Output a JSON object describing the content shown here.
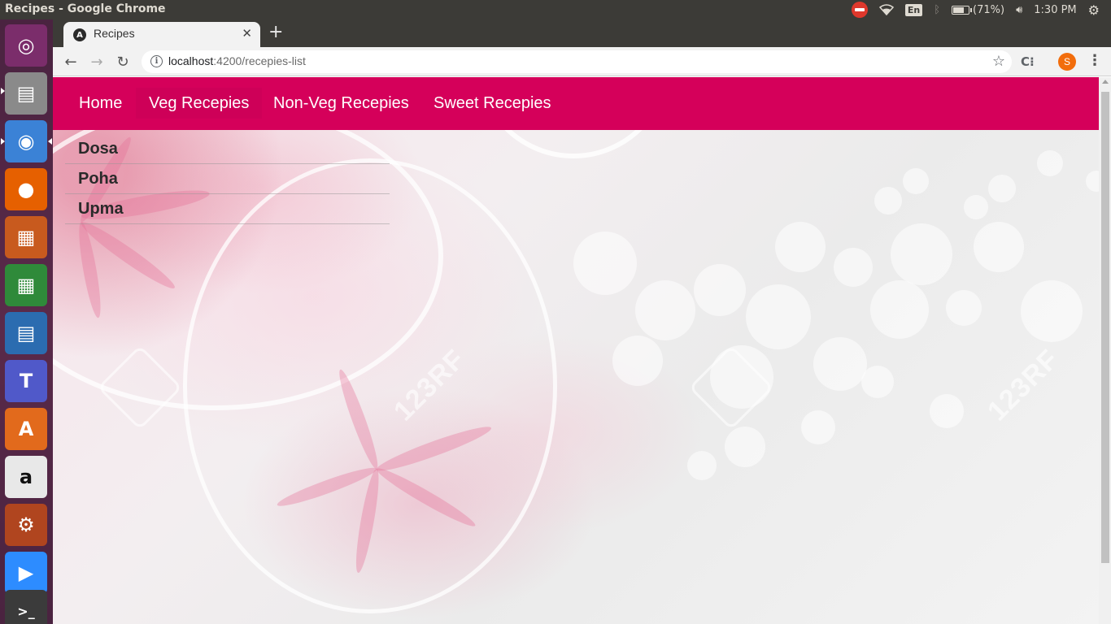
{
  "os": {
    "window_title": "Recipes - Google Chrome",
    "battery_text": "(71%)",
    "time": "1:30 PM",
    "keyboard_layout": "En"
  },
  "launcher": [
    {
      "name": "ubuntu-dash",
      "glyph": "◎",
      "color": "#7b2d6b"
    },
    {
      "name": "files",
      "glyph": "▤",
      "color": "#8a8a8a"
    },
    {
      "name": "chrome",
      "glyph": "◉",
      "color": "#3b82d6"
    },
    {
      "name": "firefox",
      "glyph": "●",
      "color": "#e66000"
    },
    {
      "name": "impress",
      "glyph": "▦",
      "color": "#c85a1e"
    },
    {
      "name": "calc",
      "glyph": "▦",
      "color": "#2f8a3a"
    },
    {
      "name": "writer",
      "glyph": "▤",
      "color": "#2b6cb0"
    },
    {
      "name": "teams",
      "glyph": "T",
      "color": "#5059c9"
    },
    {
      "name": "software",
      "glyph": "A",
      "color": "#e26a1c"
    },
    {
      "name": "amazon",
      "glyph": "a",
      "color": "#e8e8e8"
    },
    {
      "name": "settings",
      "glyph": "⚙",
      "color": "#b0451f"
    },
    {
      "name": "zoom",
      "glyph": "▶",
      "color": "#2d8cff"
    },
    {
      "name": "terminal",
      "glyph": ">_",
      "color": "#3b3b3b"
    }
  ],
  "browser": {
    "tab_title": "Recipes",
    "tab_favicon": "A",
    "url_host": "localhost",
    "url_path": ":4200/recepies-list",
    "profile_initial": "S",
    "extension_label": "C⁝"
  },
  "navbar": {
    "links": [
      {
        "label": "Home"
      },
      {
        "label": "Veg Recepies"
      },
      {
        "label": "Non-Veg Recepies"
      },
      {
        "label": "Sweet Recepies"
      }
    ],
    "active_index": 1,
    "color": "#d5005a"
  },
  "recipes": [
    "Dosa",
    "Poha",
    "Upma"
  ],
  "watermark": "123RF"
}
